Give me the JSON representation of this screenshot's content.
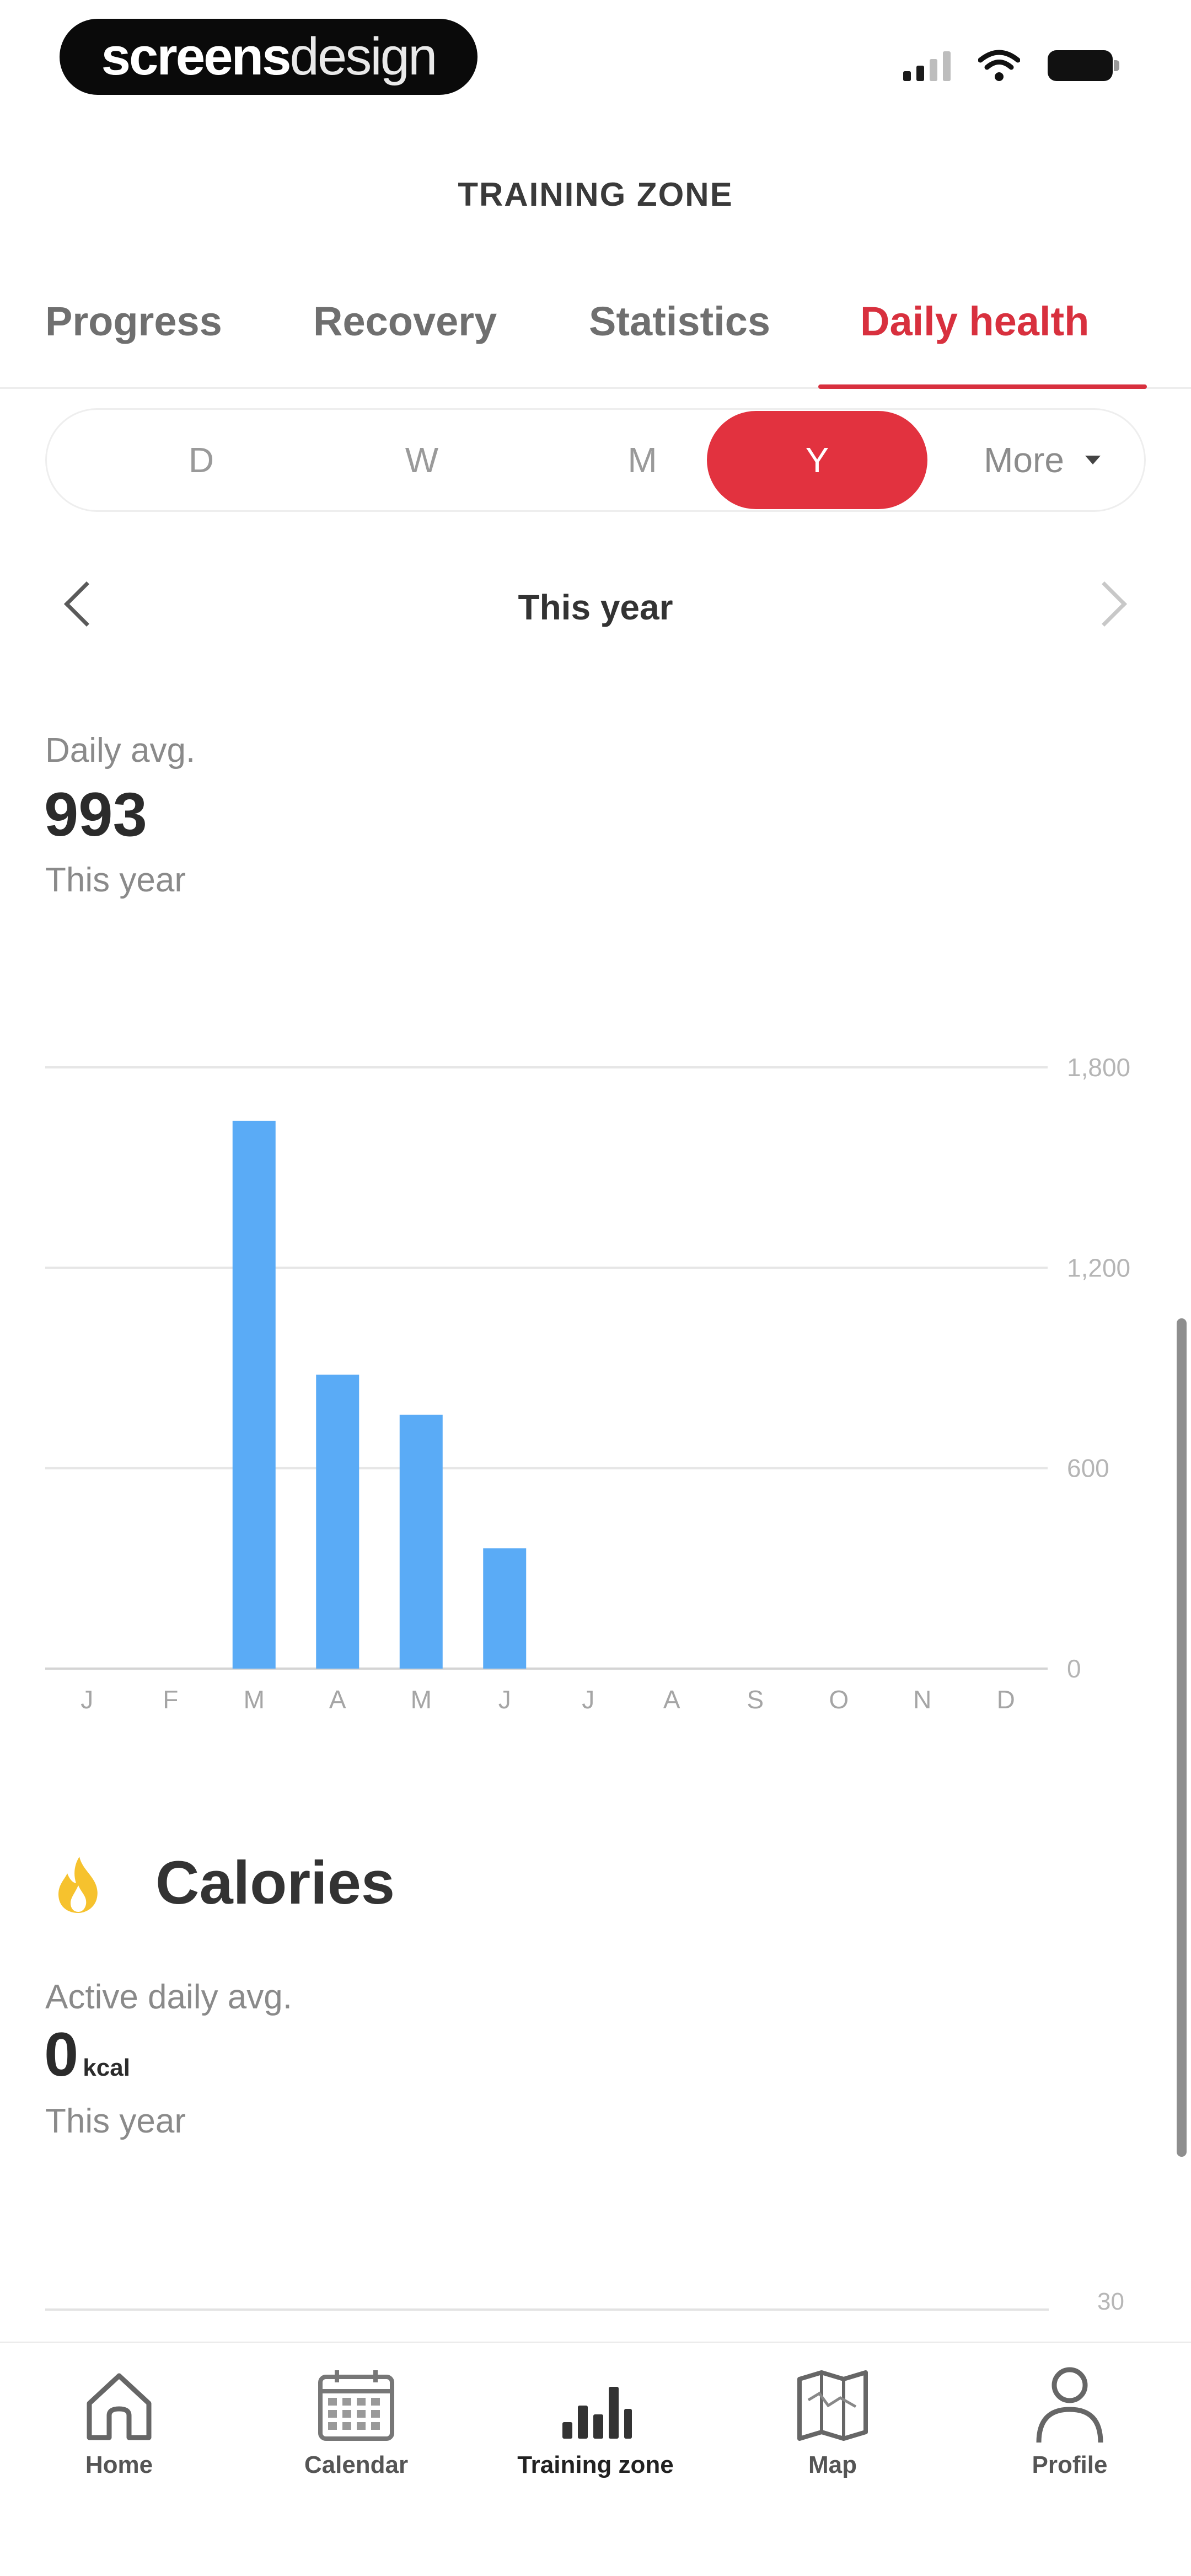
{
  "status_bar": {
    "brand_bold": "screens",
    "brand_light": "design"
  },
  "app": {
    "title": "TRAINING ZONE"
  },
  "tabs": [
    {
      "label": "Progress",
      "active": false
    },
    {
      "label": "Recovery",
      "active": false
    },
    {
      "label": "Statistics",
      "active": false
    },
    {
      "label": "Daily health",
      "active": true
    }
  ],
  "periods": [
    {
      "label": "D",
      "active": false
    },
    {
      "label": "W",
      "active": false
    },
    {
      "label": "M",
      "active": false
    },
    {
      "label": "Y",
      "active": true
    },
    {
      "label": "More",
      "active": false
    }
  ],
  "date_nav": {
    "label": "This year"
  },
  "summary": {
    "label": "Daily avg.",
    "value": "993",
    "sub": "This year"
  },
  "chart_data": {
    "type": "bar",
    "categories": [
      "J",
      "F",
      "M",
      "A",
      "M",
      "J",
      "J",
      "A",
      "S",
      "O",
      "N",
      "D"
    ],
    "values": [
      0,
      0,
      1640,
      880,
      760,
      360,
      0,
      0,
      0,
      0,
      0,
      0
    ],
    "ylim": [
      0,
      1800
    ],
    "yticks": [
      "1,800",
      "1,200",
      "600",
      "0"
    ],
    "ytick_values": [
      1800,
      1200,
      600,
      0
    ],
    "grid": true,
    "bar_color": "#5aabf6"
  },
  "calories": {
    "title": "Calories",
    "label": "Active daily avg.",
    "value": "0",
    "unit": "kcal",
    "sub": "This year",
    "top_tick": "30",
    "icon_color": "#f6c22e"
  },
  "bottom_nav": [
    {
      "label": "Home",
      "icon": "home-icon",
      "active": false
    },
    {
      "label": "Calendar",
      "icon": "calendar-icon",
      "active": false
    },
    {
      "label": "Training zone",
      "icon": "bar-chart-icon",
      "active": true
    },
    {
      "label": "Map",
      "icon": "map-icon",
      "active": false
    },
    {
      "label": "Profile",
      "icon": "profile-icon",
      "active": false
    }
  ],
  "colors": {
    "accent": "#e2323f",
    "bar": "#5aabf6",
    "flame": "#f6c22e"
  }
}
